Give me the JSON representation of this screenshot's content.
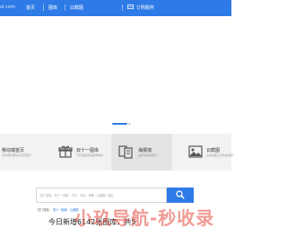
{
  "header": {
    "logo_text": "ul.com",
    "nav": [
      {
        "label": "首页"
      },
      {
        "label": "图库"
      },
      {
        "label": "云截图"
      },
      {
        "label": "订购服务"
      }
    ]
  },
  "carousel": {
    "active_index": 1,
    "dot_count": 2
  },
  "features": [
    {
      "title": "移动端首页",
      "desc": "手机端页面优化首页展示"
    },
    {
      "title": "双十一图库",
      "desc": "节日促销活动图库素材"
    },
    {
      "title": "海报墙",
      "desc": "品牌海报墙展示"
    },
    {
      "title": "云截图",
      "desc": "在线截图工具快速保存"
    }
  ],
  "search": {
    "placeholder": "热门搜索 · 双十一图库 · 节日 · 手机 · 海报 · 云截图 · 图片",
    "hot_label": "热门搜索：",
    "hot_terms": "双十一图库 · 云截图"
  },
  "headline": "今日新增6142张图库，共5",
  "watermark": "小玖导航-秒收录",
  "colors": {
    "brand_blue": "#2e7ae6",
    "feature_bg": "#f2f2f2"
  }
}
